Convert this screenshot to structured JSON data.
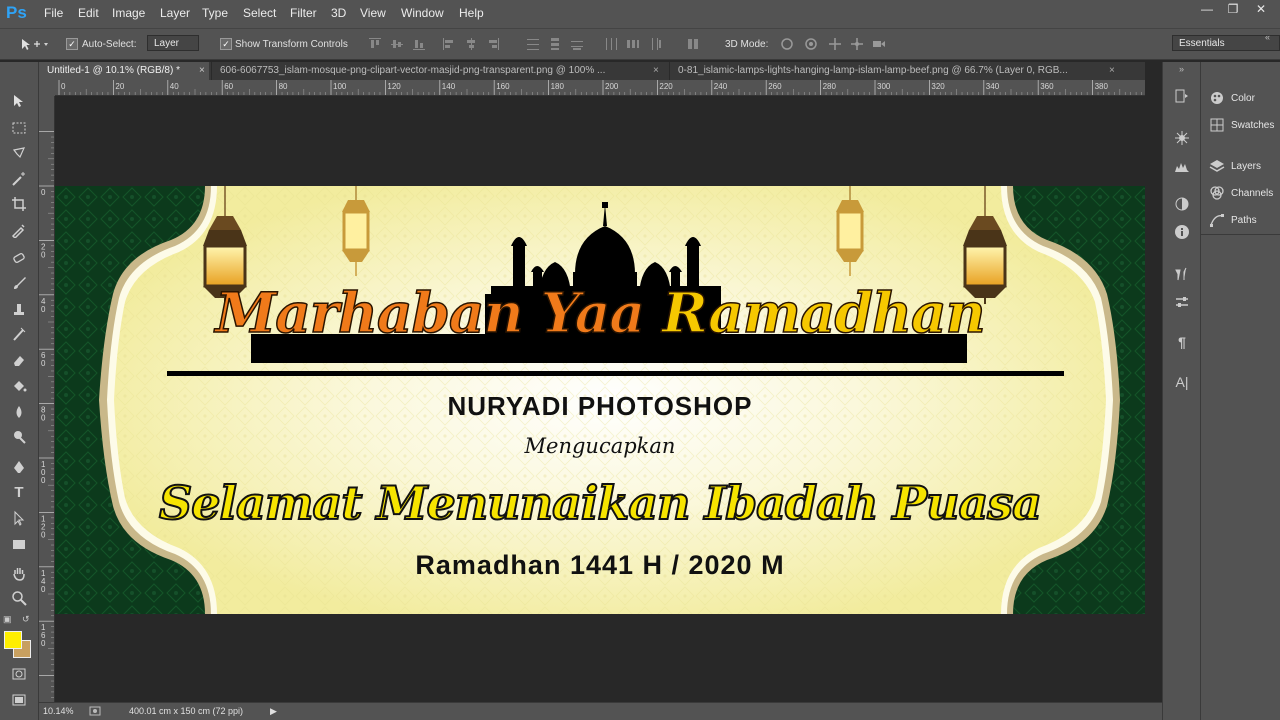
{
  "app": {
    "logo": "Ps",
    "menu": [
      "File",
      "Edit",
      "Image",
      "Layer",
      "Type",
      "Select",
      "Filter",
      "3D",
      "View",
      "Window",
      "Help"
    ],
    "window_controls": [
      "minimize-icon",
      "restore-icon",
      "close-icon"
    ]
  },
  "options_bar": {
    "auto_select_label": "Auto-Select:",
    "auto_select_value": "Layer",
    "transform_label": "Show Transform Controls",
    "mode_label": "3D Mode:",
    "workspace": "Essentials"
  },
  "tabs": [
    {
      "label": "Untitled-1 @ 10.1% (RGB/8) *",
      "active": true
    },
    {
      "label": "606-6067753_islam-mosque-png-clipart-vector-masjid-png-transparent.png @ 100% ...",
      "active": false
    },
    {
      "label": "0-81_islamic-lamps-lights-hanging-lamp-islam-lamp-beef.png @ 66.7% (Layer 0, RGB...",
      "active": false
    }
  ],
  "ruler_top": [
    "0",
    "20",
    "40",
    "60",
    "80",
    "100",
    "120",
    "140",
    "160",
    "180",
    "200",
    "220",
    "240",
    "260",
    "280",
    "300",
    "320",
    "340",
    "360",
    "380"
  ],
  "ruler_left": [
    "0",
    "2 0",
    "4 0",
    "6 0",
    "8 0",
    "1 0 0",
    "1 2 0",
    "1 4 0",
    "1 6 0"
  ],
  "colors": {
    "foreground": "#ffee00",
    "background": "#c8a060",
    "banner_green": "#0c3a1c",
    "banner_cream": "#f4f0b4",
    "title_orange": "#f08a1a",
    "title_yellow": "#f6e400"
  },
  "banner": {
    "title_part1": "Marhaban Yaa ",
    "title_part2": "Ramadhan",
    "company": "NURYADI PHOTOSHOP",
    "subtitle": "Mengucapkan",
    "greeting": "Selamat Menunaikan Ibadah Puasa",
    "date_line": "Ramadhan 1441 H / 2020 M"
  },
  "right_panels": [
    {
      "name": "Color",
      "icon": "color-palette-icon"
    },
    {
      "name": "Swatches",
      "icon": "swatches-grid-icon"
    },
    {
      "name": "Layers",
      "icon": "layers-icon"
    },
    {
      "name": "Channels",
      "icon": "channels-icon"
    },
    {
      "name": "Paths",
      "icon": "paths-icon"
    }
  ],
  "status": {
    "zoom": "10.14%",
    "doc_size": "400.01 cm x 150 cm (72 ppi)"
  }
}
